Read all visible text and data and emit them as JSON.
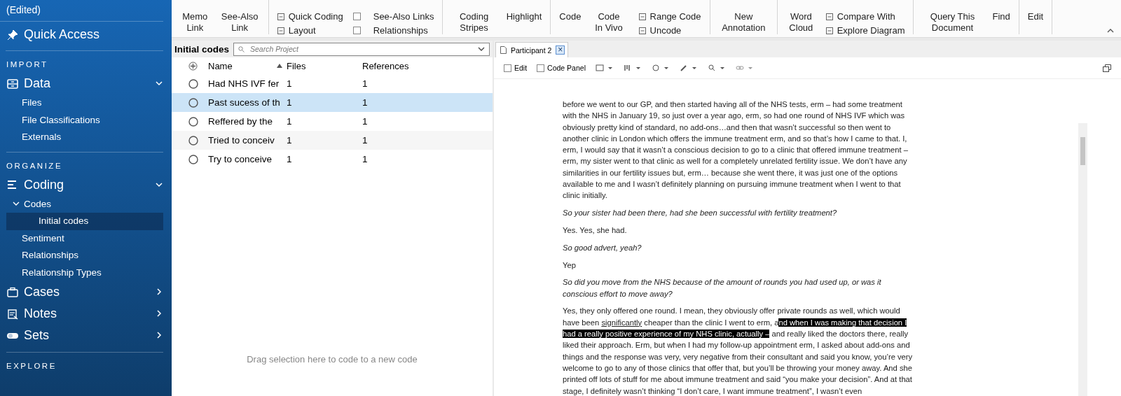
{
  "sidebar": {
    "project": "(Edited)",
    "quick_access": "Quick Access",
    "sections": [
      {
        "heading": "IMPORT",
        "groups": [
          {
            "label": "Data",
            "expanded": true,
            "children": [
              {
                "label": "Files",
                "selected": false
              },
              {
                "label": "File Classifications",
                "selected": false
              },
              {
                "label": "Externals",
                "selected": false
              }
            ]
          }
        ]
      },
      {
        "heading": "ORGANIZE",
        "groups": [
          {
            "label": "Coding",
            "expanded": true,
            "children": [
              {
                "label": "Codes",
                "selected": false,
                "expanded": true,
                "children": [
                  {
                    "label": "Initial codes",
                    "selected": true
                  }
                ]
              },
              {
                "label": "Sentiment",
                "selected": false
              },
              {
                "label": "Relationships",
                "selected": false
              },
              {
                "label": "Relationship Types",
                "selected": false
              }
            ]
          },
          {
            "label": "Cases",
            "expanded": false
          },
          {
            "label": "Notes",
            "expanded": false
          },
          {
            "label": "Sets",
            "expanded": false
          }
        ]
      },
      {
        "heading": "EXPLORE"
      }
    ]
  },
  "ribbon": {
    "groups": [
      {
        "items": [
          {
            "kind": "large",
            "label": "Memo Link"
          },
          {
            "kind": "large",
            "label": "See-Also Link"
          }
        ]
      },
      {
        "items": [
          {
            "kind": "small",
            "label": "Quick Coding"
          },
          {
            "kind": "small",
            "label": "Layout"
          },
          {
            "kind": "check",
            "label": "See-Also Links",
            "checked": false
          },
          {
            "kind": "check",
            "label": "Relationships",
            "checked": false
          }
        ]
      },
      {
        "items": [
          {
            "kind": "large",
            "label": "Coding Stripes"
          },
          {
            "kind": "large",
            "label": "Highlight"
          }
        ]
      },
      {
        "items": [
          {
            "kind": "large",
            "label": "Code"
          },
          {
            "kind": "large",
            "label": "Code In Vivo"
          },
          {
            "kind": "small",
            "label": "Range Code"
          },
          {
            "kind": "small",
            "label": "Uncode"
          }
        ]
      },
      {
        "items": [
          {
            "kind": "large",
            "label": "New Annotation"
          }
        ]
      },
      {
        "items": [
          {
            "kind": "large",
            "label": "Word Cloud"
          },
          {
            "kind": "small",
            "label": "Compare With"
          },
          {
            "kind": "small",
            "label": "Explore Diagram"
          }
        ]
      },
      {
        "items": [
          {
            "kind": "large",
            "label": "Query This Document"
          },
          {
            "kind": "large",
            "label": "Find"
          }
        ]
      },
      {
        "items": [
          {
            "kind": "large",
            "label": "Edit"
          }
        ]
      }
    ]
  },
  "codes_panel": {
    "title": "Initial codes",
    "search": {
      "placeholder": "Search Project"
    },
    "columns": [
      {
        "label": "Name",
        "sorted": false
      },
      {
        "label": "Files",
        "sorted": true
      },
      {
        "label": "References",
        "sorted": false
      }
    ],
    "rows": [
      {
        "name": "Had NHS IVF fer",
        "files": "1",
        "references": "1",
        "selected": false
      },
      {
        "name": "Past sucess of th",
        "files": "1",
        "references": "1",
        "selected": true
      },
      {
        "name": "Reffered by the",
        "files": "1",
        "references": "1",
        "selected": false
      },
      {
        "name": "Tried to conceiv",
        "files": "1",
        "references": "1",
        "selected": false
      },
      {
        "name": "Try to conceive",
        "files": "1",
        "references": "1",
        "selected": false
      }
    ],
    "drop_hint": "Drag selection here to code to a new code"
  },
  "document": {
    "tab": {
      "title": "Participant 2",
      "close": "×"
    },
    "toolbar": [
      {
        "label": "Edit",
        "checked": false
      },
      {
        "label": "Code Panel",
        "checked": false
      }
    ],
    "paragraphs": [
      {
        "kind": "answer",
        "segments": [
          {
            "kind": "plain",
            "text": "before we went to our GP, and then started having all of the NHS tests, erm – had some treatment with the NHS in January 19, so just over a year ago, erm, so had one round of NHS IVF which was obviously pretty kind of standard, no add-ons…and then that wasn’t successful so then went to another clinic  in London which offers the immune treatment erm, and so that’s how I came to that. I, erm, I would say that it wasn’t a conscious decision to go to a clinic that offered immune treatment – erm, my sister went to that clinic as well for a completely unrelated fertility issue. We don’t have any similarities in our fertility issues but, erm… because she went there, it was just one of the options available to me and I wasn’t definitely planning on pursuing immune treatment when I went to that clinic initially."
          }
        ]
      },
      {
        "kind": "question",
        "segments": [
          {
            "kind": "plain",
            "text": "So your sister had been there, had she been successful with fertility treatment?"
          }
        ]
      },
      {
        "kind": "answer",
        "segments": [
          {
            "kind": "plain",
            "text": "Yes. Yes, she had."
          }
        ]
      },
      {
        "kind": "question",
        "segments": [
          {
            "kind": "plain",
            "text": "So good advert, yeah?"
          }
        ]
      },
      {
        "kind": "answer",
        "segments": [
          {
            "kind": "plain",
            "text": "Yep"
          }
        ]
      },
      {
        "kind": "question",
        "segments": [
          {
            "kind": "plain",
            "text": "So did you move from the NHS because of the amount of rounds you had used up, or was it conscious effort to move away?"
          }
        ]
      },
      {
        "kind": "answer",
        "segments": [
          {
            "kind": "plain",
            "text": "Yes, they only offered one round. I mean, they obviously offer private rounds as well, which would have been "
          },
          {
            "kind": "underline",
            "text": "significantly"
          },
          {
            "kind": "plain",
            "text": " cheaper than the clinic I went to erm, a"
          },
          {
            "kind": "highlight",
            "text": "nd when I was making that decision I had a really positive experience of my NHS clinic, actually –"
          },
          {
            "kind": "plain",
            "text": " and really liked the doctors there, really liked their approach. Erm, but when I had my follow-up appointment erm, I asked about add-ons and things and the response was very, very negative from their consultant and said you know, you’re very welcome to go to any of those clinics that offer that, but you’ll be throwing your money away. And she printed off lots of stuff for me about immune treatment and said “you make your decision”. And at that stage, I definitely wasn’t thinking “I don’t care, I want immune treatment”, I wasn’t even"
          }
        ]
      }
    ]
  }
}
